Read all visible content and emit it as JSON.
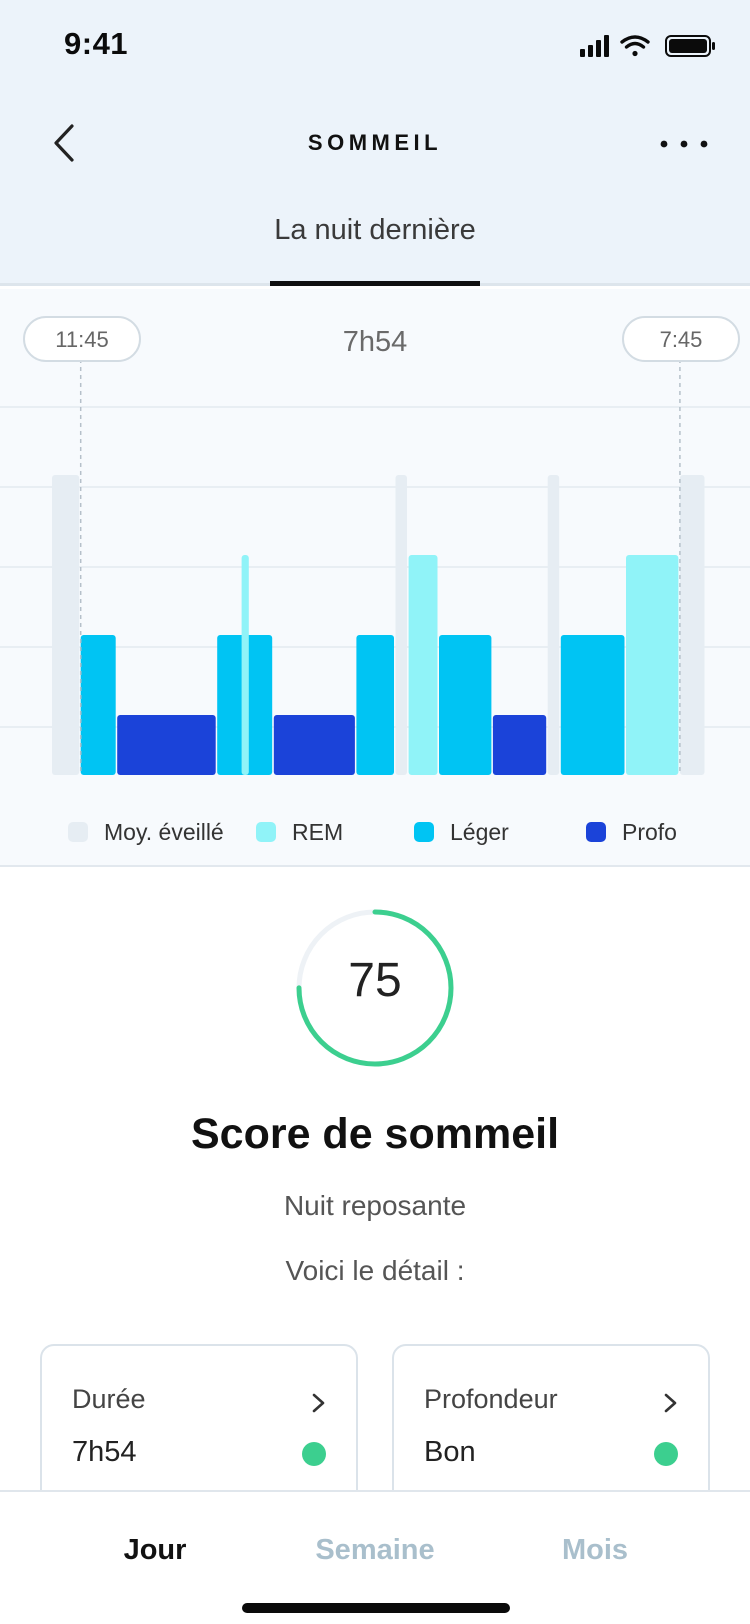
{
  "status_bar": {
    "time": "9:41"
  },
  "nav": {
    "title": "SOMMEIL"
  },
  "tabs": {
    "active": "La nuit dernière"
  },
  "chart_data": {
    "type": "bar",
    "bedtime": "11:45",
    "waketime": "7:45",
    "duration": "7h54",
    "stage_levels": {
      "awake": 4,
      "rem": 3,
      "light": 2,
      "deep": 1
    },
    "segments": [
      {
        "stage": "awake",
        "start": 0.0,
        "end": 0.33
      },
      {
        "stage": "light",
        "start": 0.33,
        "end": 0.75
      },
      {
        "stage": "deep",
        "start": 0.75,
        "end": 1.9
      },
      {
        "stage": "light",
        "start": 1.9,
        "end": 2.55
      },
      {
        "stage": "rem",
        "start": 2.18,
        "end": 2.28
      },
      {
        "stage": "deep",
        "start": 2.55,
        "end": 3.5
      },
      {
        "stage": "light",
        "start": 3.5,
        "end": 3.95
      },
      {
        "stage": "awake",
        "start": 3.95,
        "end": 4.1
      },
      {
        "stage": "rem",
        "start": 4.1,
        "end": 4.45
      },
      {
        "stage": "light",
        "start": 4.45,
        "end": 5.07
      },
      {
        "stage": "deep",
        "start": 5.07,
        "end": 5.7
      },
      {
        "stage": "awake",
        "start": 5.7,
        "end": 5.85
      },
      {
        "stage": "light",
        "start": 5.85,
        "end": 6.6
      },
      {
        "stage": "rem",
        "start": 6.6,
        "end": 7.22
      },
      {
        "stage": "awake",
        "start": 7.22,
        "end": 7.52
      }
    ],
    "legend": [
      {
        "key": "awake",
        "label": "Moy. éveillé",
        "color": "#e6edf3"
      },
      {
        "key": "rem",
        "label": "REM",
        "color": "#90f3f8"
      },
      {
        "key": "light",
        "label": "Léger",
        "color": "#00c4f3"
      },
      {
        "key": "deep",
        "label": "Profo",
        "color": "#1b43d9"
      }
    ],
    "grid": true
  },
  "score": {
    "value": "75",
    "fraction": 0.75,
    "color": "#3ccf8f",
    "title": "Score de sommeil",
    "subtitle": "Nuit reposante",
    "detail": "Voici le détail :"
  },
  "cards": [
    {
      "label": "Durée",
      "value": "7h54"
    },
    {
      "label": "Profondeur",
      "value": "Bon"
    }
  ],
  "bottom_tabs": [
    {
      "label": "Jour",
      "active": true
    },
    {
      "label": "Semaine",
      "active": false
    },
    {
      "label": "Mois",
      "active": false
    }
  ]
}
